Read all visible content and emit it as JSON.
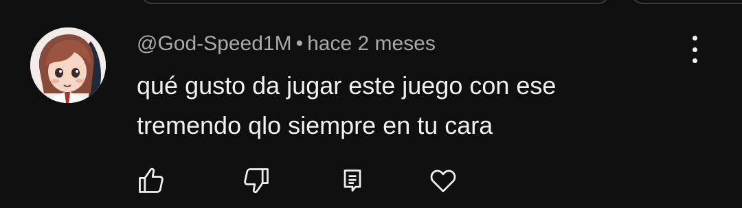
{
  "comment": {
    "author": "@God-Speed1M",
    "separator": "•",
    "time": "hace 2 meses",
    "text_lines": [
      "qué gusto da jugar este juego con ese",
      "tremendo qlo siempre en tu cara"
    ]
  },
  "icons": {
    "avatar": "anime-avatar",
    "more": "more-vertical-icon",
    "like": "thumbs-up-icon",
    "dislike": "thumbs-down-icon",
    "reply": "reply-comment-icon",
    "heart": "heart-icon"
  },
  "colors": {
    "background": "#0f0f0f",
    "text_primary": "#f1f1f1",
    "text_secondary": "#aaaaaa"
  }
}
